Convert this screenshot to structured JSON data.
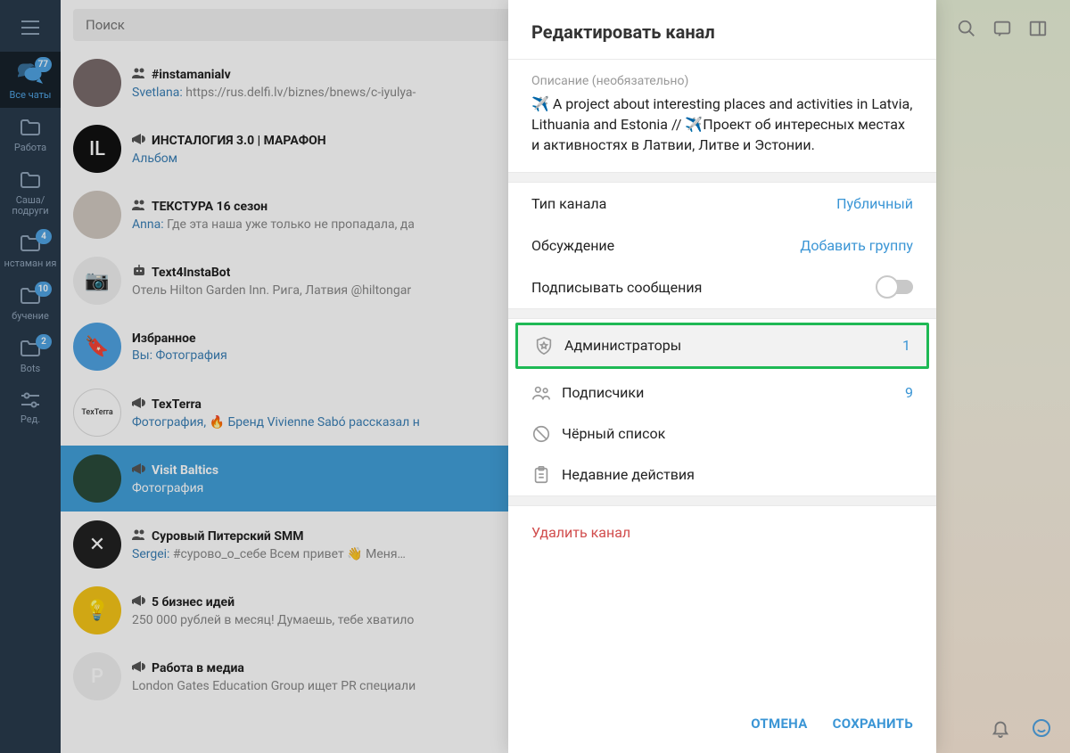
{
  "search": {
    "placeholder": "Поиск"
  },
  "folders": [
    {
      "key": "all",
      "label": "Все чаты",
      "badge": "77",
      "icon": "chats"
    },
    {
      "key": "work",
      "label": "Работа",
      "icon": "folder"
    },
    {
      "key": "friends",
      "label": "Саша/ подруги",
      "icon": "folder"
    },
    {
      "key": "insta",
      "label": "нстаман ия",
      "badge": "4",
      "icon": "folder"
    },
    {
      "key": "learn",
      "label": "бучение",
      "badge": "10",
      "icon": "folder"
    },
    {
      "key": "bots",
      "label": "Bots",
      "badge": "2",
      "icon": "folder"
    },
    {
      "key": "edit",
      "label": "Ред.",
      "icon": "sliders"
    }
  ],
  "chats": [
    {
      "type": "group",
      "name": "#instamanialv",
      "sender": "Svetlana",
      "preview": "https://rus.delfi.lv/biznes/bnews/c-iyulya-",
      "ava": "#7a6c6c",
      "txt": ""
    },
    {
      "type": "channel",
      "name": "ИНСТАЛОГИЯ 3.0 | МАРАФОН",
      "sender": "",
      "preview": "Альбом",
      "previewLink": true,
      "ava": "#111",
      "txt": "IL"
    },
    {
      "type": "group",
      "name": "ТЕКСТУРА 16 сезон",
      "sender": "Anna",
      "preview": "Где эта наша уже только не пропадала, да",
      "ava": "#d0c8c0",
      "txt": ""
    },
    {
      "type": "bot",
      "name": "Text4InstaBot",
      "sender": "",
      "preview": "Отель Hilton Garden Inn. Рига, Латвия @hiltongar",
      "ava": "#f0f0f0",
      "txt": "📷"
    },
    {
      "type": "saved",
      "name": "Избранное",
      "sender": "Вы",
      "preview": "Фотография",
      "previewLink": true,
      "ava": "#4fa3e2",
      "txt": "🔖"
    },
    {
      "type": "channel",
      "name": "TexTerra",
      "sender": "",
      "preview": "Фотография, 🔥 Бренд Vivienne Sabó рассказал н",
      "previewLink": true,
      "ava": "#fff",
      "txt": "TexTerra",
      "txtsm": true
    },
    {
      "type": "channel",
      "name": "Visit Baltics",
      "sender": "",
      "preview": "Фотография",
      "sel": true,
      "ava": "#2a4a3a",
      "txt": ""
    },
    {
      "type": "group",
      "name": "Суровый Питерский SMM",
      "sender": "Sergei",
      "preview": "#сурово_о_себе  Всем привет 👋  Меня…",
      "ava": "#222",
      "txt": "✕"
    },
    {
      "type": "channel",
      "name": "5 бизнес идей",
      "sender": "",
      "preview": "250 000 рублей в месяц!   Думаешь, тебе хватило",
      "ava": "#f5c518",
      "txt": "💡"
    },
    {
      "type": "channel",
      "name": "Работа в медиа",
      "sender": "",
      "preview": "London Gates Education Group ищет PR специали",
      "ava": "#f0f0f0",
      "txt": "Р"
    }
  ],
  "modal": {
    "title": "Редактировать канал",
    "descLabel": "Описание (необязательно)",
    "desc": "✈️  A project about interesting places and activities in Latvia, Lithuania and Estonia // ✈️Проект об интересных местах и активностях в Латвии, Литве и Эстонии.",
    "channelTypeLabel": "Тип канала",
    "channelTypeValue": "Публичный",
    "discussionLabel": "Обсуждение",
    "discussionValue": "Добавить группу",
    "signLabel": "Подписывать сообщения",
    "admins": {
      "label": "Администраторы",
      "value": "1"
    },
    "subs": {
      "label": "Подписчики",
      "value": "9"
    },
    "blacklist": "Чёрный список",
    "recent": "Недавние действия",
    "delete": "Удалить канал",
    "cancel": "ОТМЕНА",
    "save": "СОХРАНИТЬ"
  }
}
